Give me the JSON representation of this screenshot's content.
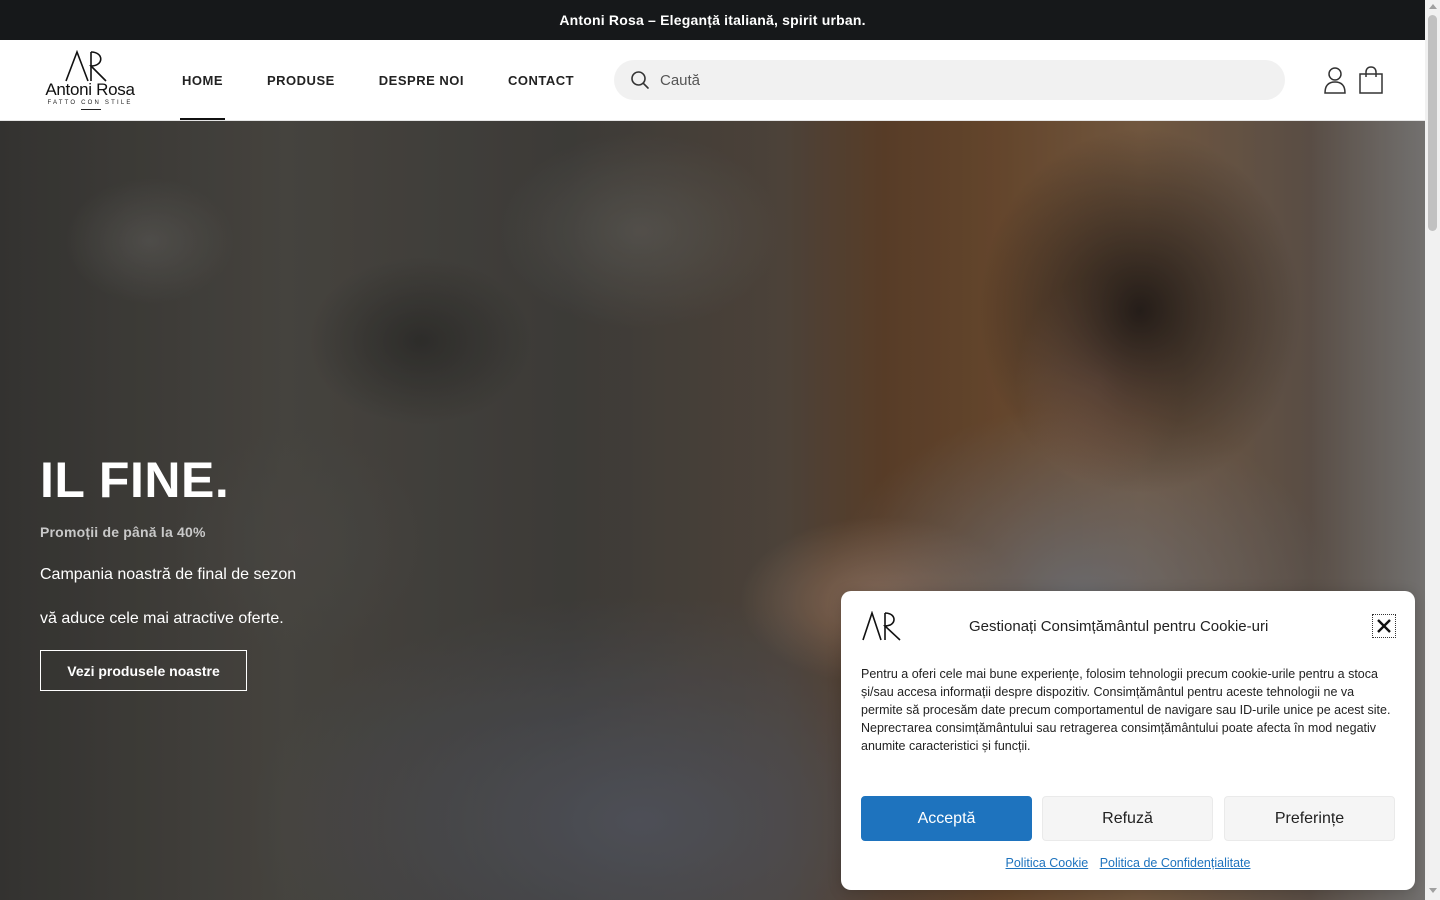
{
  "announcement": "Antoni Rosa – Eleganță italiană, spirit urban.",
  "brand": {
    "name": "Antoni Rosa",
    "tagline": "FATTO CON STILE",
    "monogram": "AR"
  },
  "nav": {
    "items": [
      {
        "label": "HOME",
        "active": true
      },
      {
        "label": "PRODUSE",
        "active": false
      },
      {
        "label": "DESPRE NOI",
        "active": false
      },
      {
        "label": "CONTACT",
        "active": false
      }
    ]
  },
  "search": {
    "placeholder": "Caută",
    "icon": "search-icon"
  },
  "header_icons": [
    "account-icon",
    "cart-icon"
  ],
  "hero": {
    "title": "IL FINE.",
    "subtitle": "Promoții de până la 40%",
    "line1": "Campania noastră de final de sezon",
    "line2": "vă aduce cele mai atractive oferte.",
    "button": "Vezi produsele noastre"
  },
  "cookie": {
    "title": "Gestionați Consimțământul pentru Cookie-uri",
    "text": "Pentru a oferi cele mai bune experiențe, folosim tehnologii precum cookie-urile pentru a stoca și/sau accesa informații despre dispozitiv. Consimțământul pentru aceste tehnologii ne va permite să procesăm date precum comportamentul de navigare sau ID-urile unice pe acest site. Nepreстarea consimțământului sau retragerea consimțământului poate afecta în mod negativ anumite caracteristici și funcții.",
    "accept": "Acceptă",
    "deny": "Refuză",
    "preferences": "Preferințe",
    "link_cookie": "Politica Cookie",
    "link_privacy": "Politica de Confidențialitate"
  },
  "colors": {
    "topbar": "#16181a",
    "accent": "#1e73be",
    "text": "#222222"
  }
}
